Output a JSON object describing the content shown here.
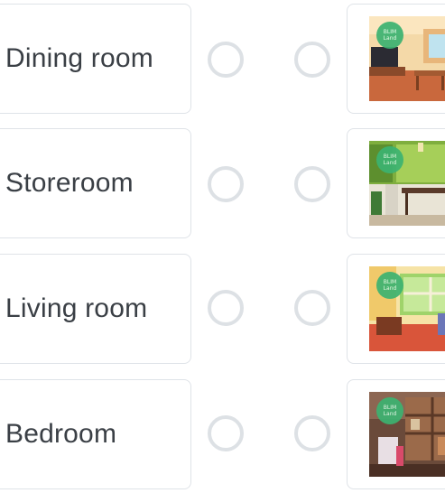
{
  "options": [
    {
      "label": "Dining room",
      "badge": "BLIM\nLand"
    },
    {
      "label": "Storeroom",
      "badge": "BLIM\nLand"
    },
    {
      "label": "Living room",
      "badge": "BLIM\nLand"
    },
    {
      "label": "Bedroom",
      "badge": "BLIM\nLand"
    }
  ],
  "colors": {
    "card_border": "#dfe3e8",
    "radio_border": "#dde1e5",
    "label_text": "#3a3f45",
    "badge_green": "#3cb371"
  }
}
